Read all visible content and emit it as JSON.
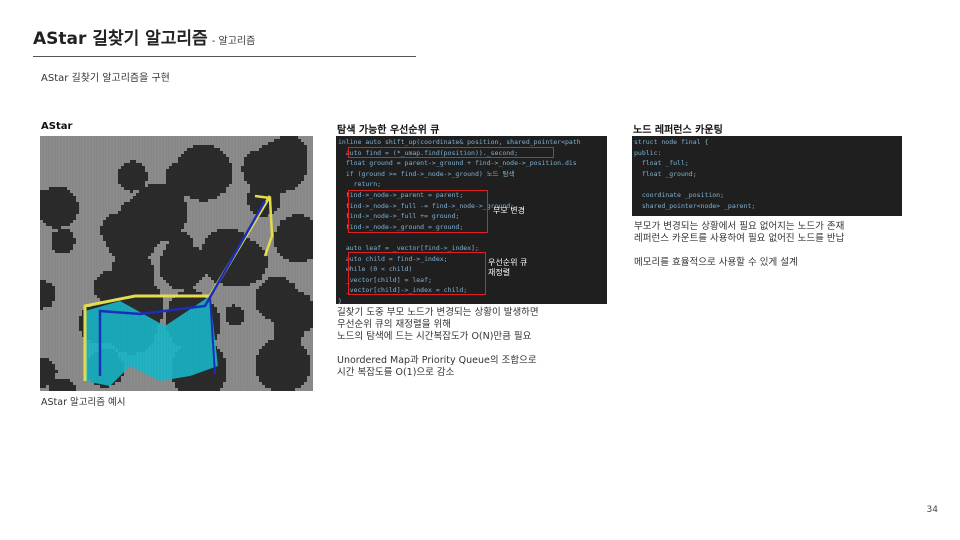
{
  "slide": {
    "title": "AStar 길찾기 알고리즘",
    "subtitle": "- 알고리즘",
    "intro": "AStar 길찾기 알고리즘을 구현",
    "page_number": "34"
  },
  "astar": {
    "heading": "AStar",
    "caption": "AStar 알고리즘 예시"
  },
  "queue": {
    "heading": "탐색 가능한 우선순위 큐",
    "code_lines": [
      "inline auto shift_up(coordinate& position, shared_pointer<path",
      "  auto find = (*_umap.find(position))._second;",
      "  float ground = parent->_ground + find->_node->_position.dis",
      "  if (ground >= find->_node->_ground) 노드 탐색",
      "    return;",
      "  find->_node->_parent = parent;",
      "  find->_node->_full -= find->_node->_ground;",
      "  find->_node->_full += ground;",
      "  find->_node->_ground = ground;",
      "",
      "  auto leaf = _vector[find->_index];",
      "  auto child = find->_index;",
      "  while (0 < child)",
      "  _vector[child] = leaf;",
      "  _vector[child]->_index = child;",
      "}"
    ],
    "notes": {
      "search": "노드 탐색",
      "parent_change": "부모 변경",
      "requeue": "우선순위 큐\n재정렬"
    },
    "description": "길찾기 도중 부모 노드가 변경되는 상황이 발생하면\n우선순위 큐의 재정렬을 위해\n노드의 탐색에 드는 시간복잡도가 O(N)만큼 필요\n\nUnordered Map과 Priority Queue의 조합으로\n시간 복잡도를 O(1)으로 감소"
  },
  "refcount": {
    "heading": "노드 레퍼런스 카운팅",
    "code_lines": [
      "struct node final {",
      "public:",
      "  float _full;",
      "  float _ground;",
      "",
      "  coordinate _position;",
      "  shared_pointer<node> _parent;"
    ],
    "description": "부모가 변경되는 상황에서 필요 없어지는 노드가 존재\n레퍼런스 카운트를 사용하여 필요 없어진 노드를 반납\n\n메모리를 효율적으로 사용할 수 있게 설계"
  },
  "colors": {
    "wall": "#2b2b2b",
    "floor": "#8c8c8c",
    "explored": "#18b7c9",
    "path": "#1a2fbf",
    "frontier": "#e8e050",
    "code_bg": "#1f1f1f",
    "highlight_box": "#e02020"
  }
}
